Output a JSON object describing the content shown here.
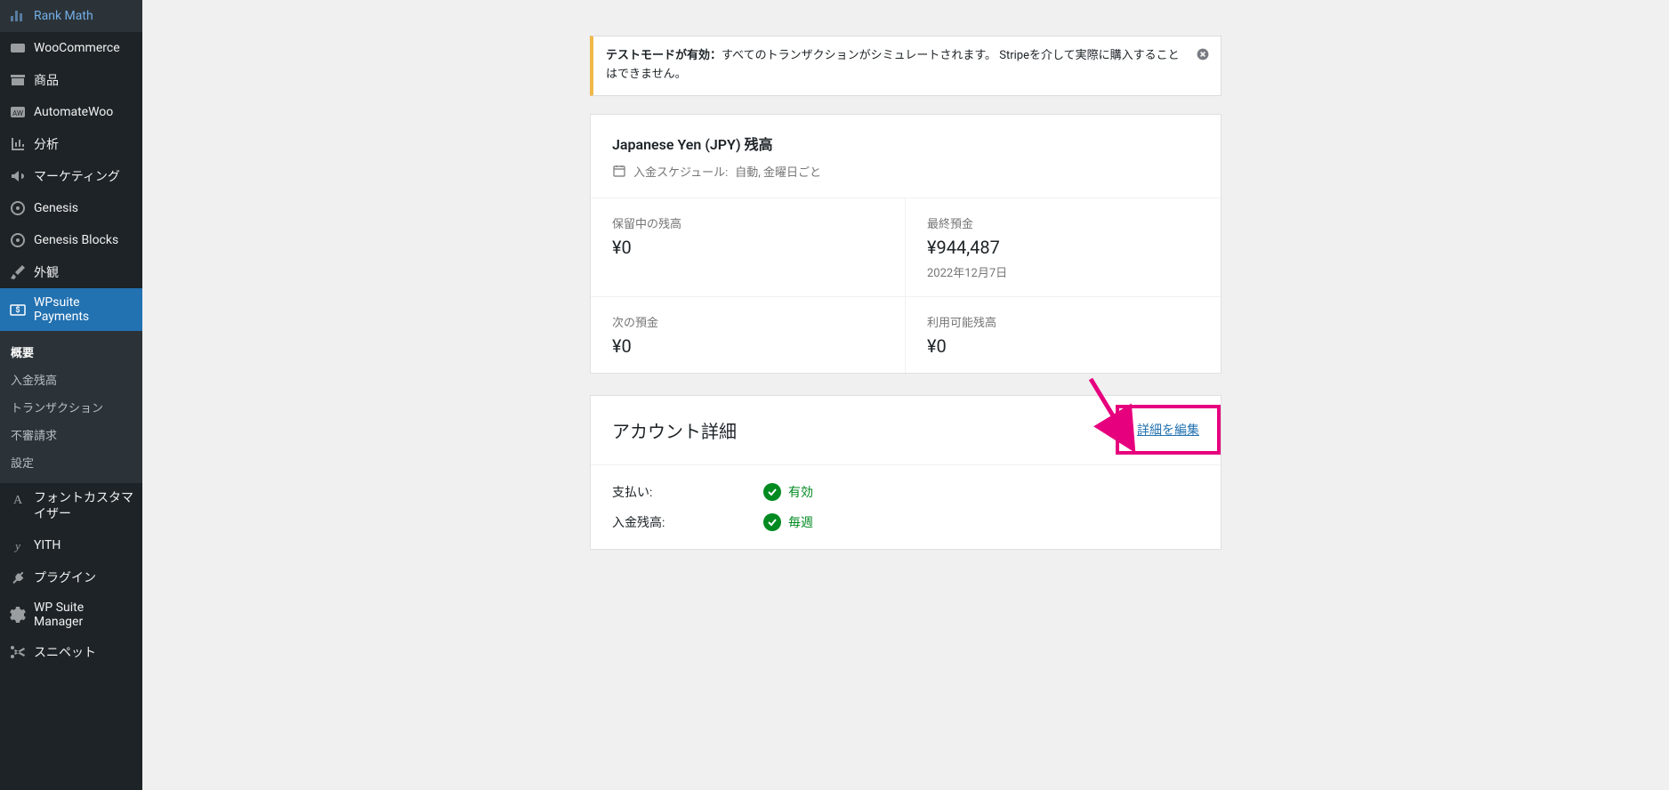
{
  "sidebar": {
    "items": [
      {
        "label": "Rank Math",
        "icon": "chart"
      },
      {
        "label": "WooCommerce",
        "icon": "woo"
      },
      {
        "label": "商品",
        "icon": "archive"
      },
      {
        "label": "AutomateWoo",
        "icon": "aw"
      },
      {
        "label": "分析",
        "icon": "analytics"
      },
      {
        "label": "マーケティング",
        "icon": "megaphone"
      },
      {
        "label": "Genesis",
        "icon": "genesis"
      },
      {
        "label": "Genesis Blocks",
        "icon": "genesis"
      },
      {
        "label": "外観",
        "icon": "brush"
      },
      {
        "label": "WPsuite Payments",
        "icon": "payments",
        "current": true
      },
      {
        "label": "フォントカスタマイザー",
        "icon": "font"
      },
      {
        "label": "YITH",
        "icon": "yith"
      },
      {
        "label": "プラグイン",
        "icon": "plugin"
      },
      {
        "label": "WP Suite Manager",
        "icon": "gear"
      },
      {
        "label": "スニペット",
        "icon": "scissors"
      }
    ],
    "submenu": [
      {
        "label": "概要",
        "active": true
      },
      {
        "label": "入金残高"
      },
      {
        "label": "トランザクション"
      },
      {
        "label": "不審請求"
      },
      {
        "label": "設定"
      }
    ]
  },
  "notice": {
    "strong": "テストモードが有効：",
    "text": "すべてのトランザクションがシミュレートされます。 Stripeを介して実際に購入することはできません。"
  },
  "balance": {
    "title": "Japanese Yen (JPY) 残高",
    "schedule_label": "入金スケジュール:",
    "schedule_value": "自動, 金曜日ごと",
    "pending_label": "保留中の残高",
    "pending_value": "¥0",
    "last_deposit_label": "最終預金",
    "last_deposit_value": "¥944,487",
    "last_deposit_date": "2022年12月7日",
    "next_deposit_label": "次の預金",
    "next_deposit_value": "¥0",
    "available_label": "利用可能残高",
    "available_value": "¥0"
  },
  "account": {
    "title": "アカウント詳細",
    "edit_link": "詳細を編集",
    "rows": [
      {
        "label": "支払い:",
        "status": "有効"
      },
      {
        "label": "入金残高:",
        "status": "毎週"
      }
    ]
  }
}
